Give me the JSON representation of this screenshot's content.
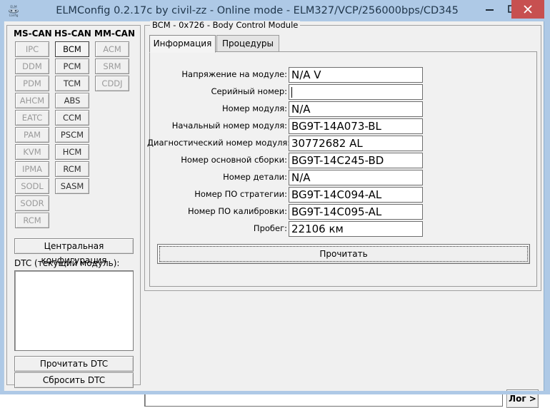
{
  "window": {
    "title": "ELMConfig 0.2.17c by civil-zz - Online mode - ELM327/VCP/256000bps/CD345",
    "icon": "elm-app-icon",
    "controls": {
      "minimize": "minimize-icon",
      "maximize": "maximize-icon",
      "close": "close-icon"
    },
    "colors": {
      "titlebar": "#aec9e6",
      "close_button": "#c75050",
      "client_background": "#f0f0f0",
      "field_background": "#ffffff"
    }
  },
  "buses": [
    {
      "name": "MS-CAN",
      "modules": [
        {
          "label": "IPC",
          "enabled": false,
          "selected": false
        },
        {
          "label": "DDM",
          "enabled": false,
          "selected": false
        },
        {
          "label": "PDM",
          "enabled": false,
          "selected": false
        },
        {
          "label": "AHCM",
          "enabled": false,
          "selected": false
        },
        {
          "label": "EATC",
          "enabled": false,
          "selected": false
        },
        {
          "label": "PAM",
          "enabled": false,
          "selected": false
        },
        {
          "label": "KVM",
          "enabled": false,
          "selected": false
        },
        {
          "label": "IPMA",
          "enabled": false,
          "selected": false
        },
        {
          "label": "SODL",
          "enabled": false,
          "selected": false
        },
        {
          "label": "SODR",
          "enabled": false,
          "selected": false
        },
        {
          "label": "RCM",
          "enabled": false,
          "selected": false
        }
      ]
    },
    {
      "name": "HS-CAN",
      "modules": [
        {
          "label": "BCM",
          "enabled": true,
          "selected": true
        },
        {
          "label": "PCM",
          "enabled": true,
          "selected": false
        },
        {
          "label": "TCM",
          "enabled": true,
          "selected": false
        },
        {
          "label": "ABS",
          "enabled": true,
          "selected": false
        },
        {
          "label": "CCM",
          "enabled": true,
          "selected": false
        },
        {
          "label": "PSCM",
          "enabled": true,
          "selected": false
        },
        {
          "label": "HCM",
          "enabled": true,
          "selected": false
        },
        {
          "label": "RCM",
          "enabled": true,
          "selected": false
        },
        {
          "label": "SASM",
          "enabled": true,
          "selected": false
        }
      ]
    },
    {
      "name": "MM-CAN",
      "modules": [
        {
          "label": "ACM",
          "enabled": false,
          "selected": false
        },
        {
          "label": "SRM",
          "enabled": false,
          "selected": false
        },
        {
          "label": "CDDJ",
          "enabled": false,
          "selected": false
        }
      ]
    }
  ],
  "left_panel": {
    "central_config_button": "Центральная конфигурация",
    "dtc_label": "DTC (текущий модуль):",
    "dtc_items": [],
    "read_dtc_button": "Прочитать DTC",
    "clear_dtc_button": "Сбросить DTC"
  },
  "main_panel": {
    "group_title": "BCM - 0x726 - Body Control Module",
    "tabs": [
      {
        "label": "Информация",
        "active": true
      },
      {
        "label": "Процедуры",
        "active": false
      }
    ],
    "fields": [
      {
        "label": "Напряжение на модуле:",
        "value": "N/A V",
        "focused": false
      },
      {
        "label": "Серийный номер:",
        "value": "",
        "focused": true
      },
      {
        "label": "Номер модуля:",
        "value": "N/A",
        "focused": false
      },
      {
        "label": "Начальный номер модуля:",
        "value": "BG9T-14A073-BL",
        "focused": false
      },
      {
        "label": "Диагностический номер модуля:",
        "value": "30772682 AL",
        "focused": false
      },
      {
        "label": "Номер основной сборки:",
        "value": "BG9T-14C245-BD",
        "focused": false
      },
      {
        "label": "Номер детали:",
        "value": "N/A",
        "focused": false
      },
      {
        "label": "Номер ПО стратегии:",
        "value": "BG9T-14C094-AL",
        "focused": false
      },
      {
        "label": "Номер ПО калибровки:",
        "value": "BG9T-14C095-AL",
        "focused": false
      },
      {
        "label": "Пробег:",
        "value": "22106 км",
        "focused": false
      }
    ],
    "read_button": "Прочитать"
  },
  "bottom_bar": {
    "command_value": "",
    "command_placeholder": "",
    "log_button": "Лог >"
  }
}
